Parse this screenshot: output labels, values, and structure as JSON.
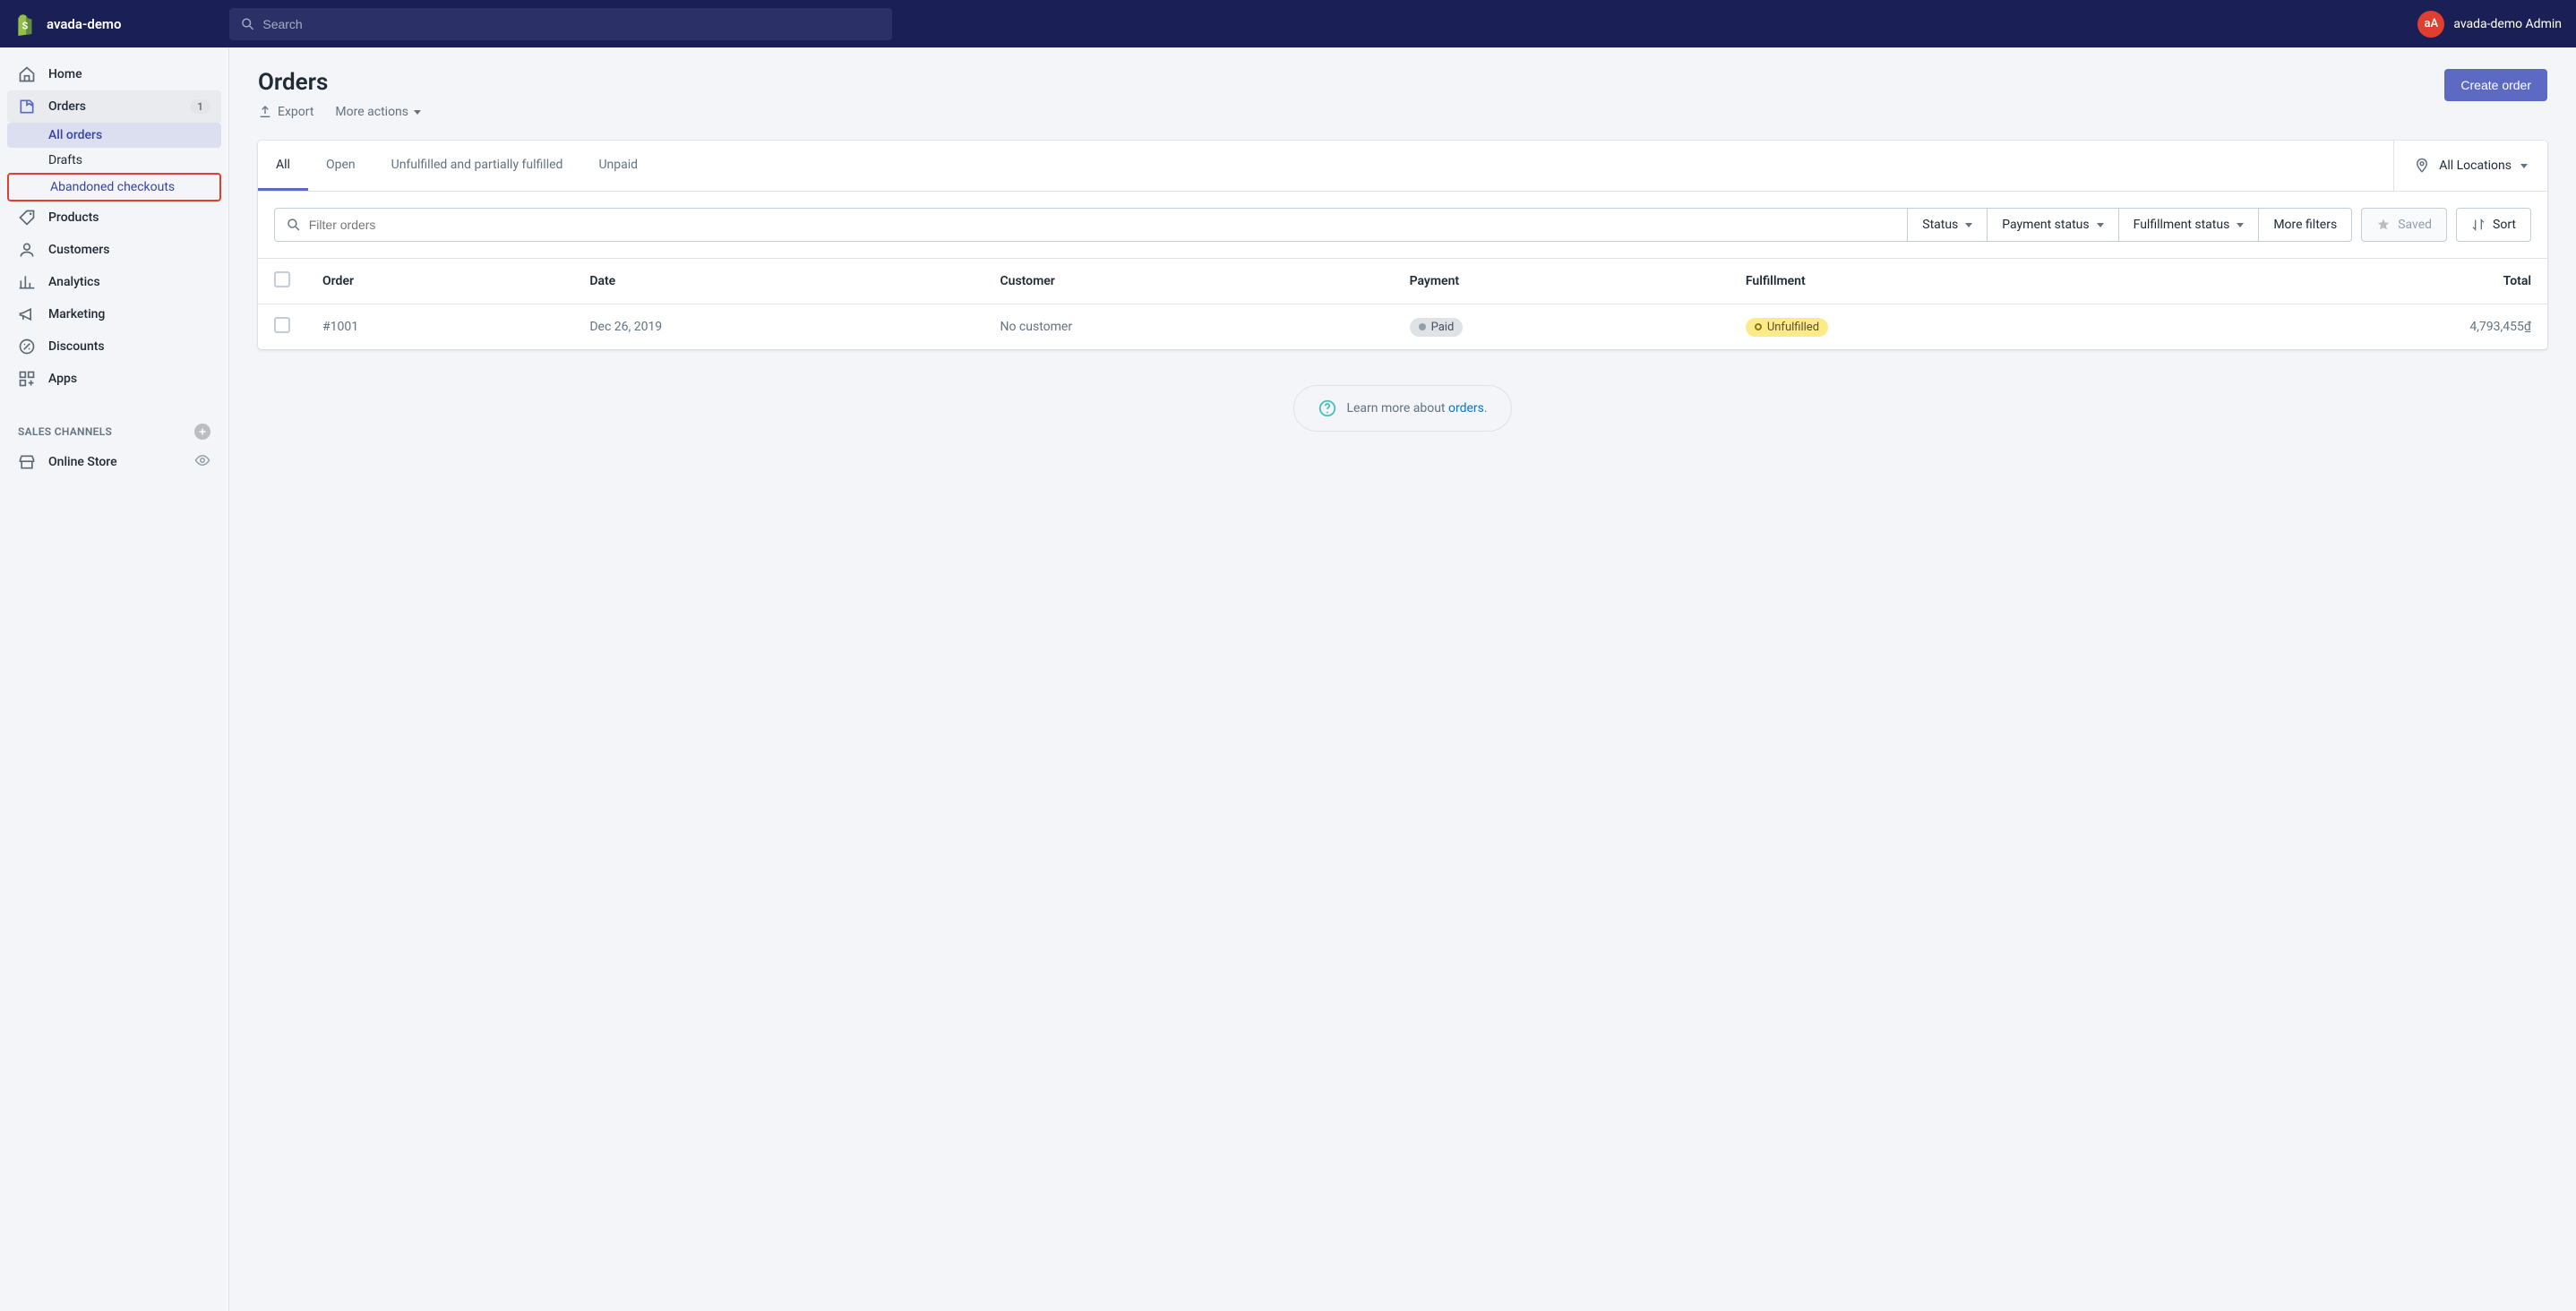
{
  "topbar": {
    "store_name": "avada-demo",
    "search_placeholder": "Search",
    "user_abbrev": "aA",
    "user_label": "avada-demo Admin"
  },
  "sidebar": {
    "items": [
      {
        "label": "Home"
      },
      {
        "label": "Orders",
        "badge": "1"
      },
      {
        "label": "Products"
      },
      {
        "label": "Customers"
      },
      {
        "label": "Analytics"
      },
      {
        "label": "Marketing"
      },
      {
        "label": "Discounts"
      },
      {
        "label": "Apps"
      }
    ],
    "orders_sub": [
      {
        "label": "All orders"
      },
      {
        "label": "Drafts"
      },
      {
        "label": "Abandoned checkouts"
      }
    ],
    "sales_channels_heading": "SALES CHANNELS",
    "channels": [
      {
        "label": "Online Store"
      }
    ]
  },
  "page": {
    "title": "Orders",
    "export_label": "Export",
    "more_actions_label": "More actions",
    "create_order_label": "Create order"
  },
  "tabs": {
    "items": [
      "All",
      "Open",
      "Unfulfilled and partially fulfilled",
      "Unpaid"
    ],
    "location_label": "All Locations"
  },
  "filters": {
    "search_placeholder": "Filter orders",
    "status_label": "Status",
    "payment_status_label": "Payment status",
    "fulfillment_status_label": "Fulfillment status",
    "more_filters_label": "More filters",
    "saved_label": "Saved",
    "sort_label": "Sort"
  },
  "table": {
    "headers": {
      "order": "Order",
      "date": "Date",
      "customer": "Customer",
      "payment": "Payment",
      "fulfillment": "Fulfillment",
      "total": "Total"
    },
    "rows": [
      {
        "order": "#1001",
        "date": "Dec 26, 2019",
        "customer": "No customer",
        "payment_badge": "Paid",
        "fulfillment_badge": "Unfulfilled",
        "total": "4,793,455₫"
      }
    ]
  },
  "learn": {
    "prefix": "Learn more about ",
    "link": "orders",
    "suffix": "."
  }
}
